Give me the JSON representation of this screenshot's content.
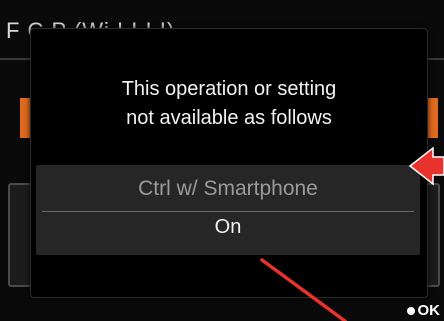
{
  "screen": {
    "background_title": "F C P        (Wi      I  I  I  I)",
    "ok_label": "OK"
  },
  "dialog": {
    "message_line1": "This operation or setting",
    "message_line2": "not available as follows",
    "setting_name": "Ctrl w/ Smartphone",
    "setting_value": "On"
  },
  "colors": {
    "accent_orange": "#e06a1f",
    "annotation_red": "#e8322e"
  }
}
